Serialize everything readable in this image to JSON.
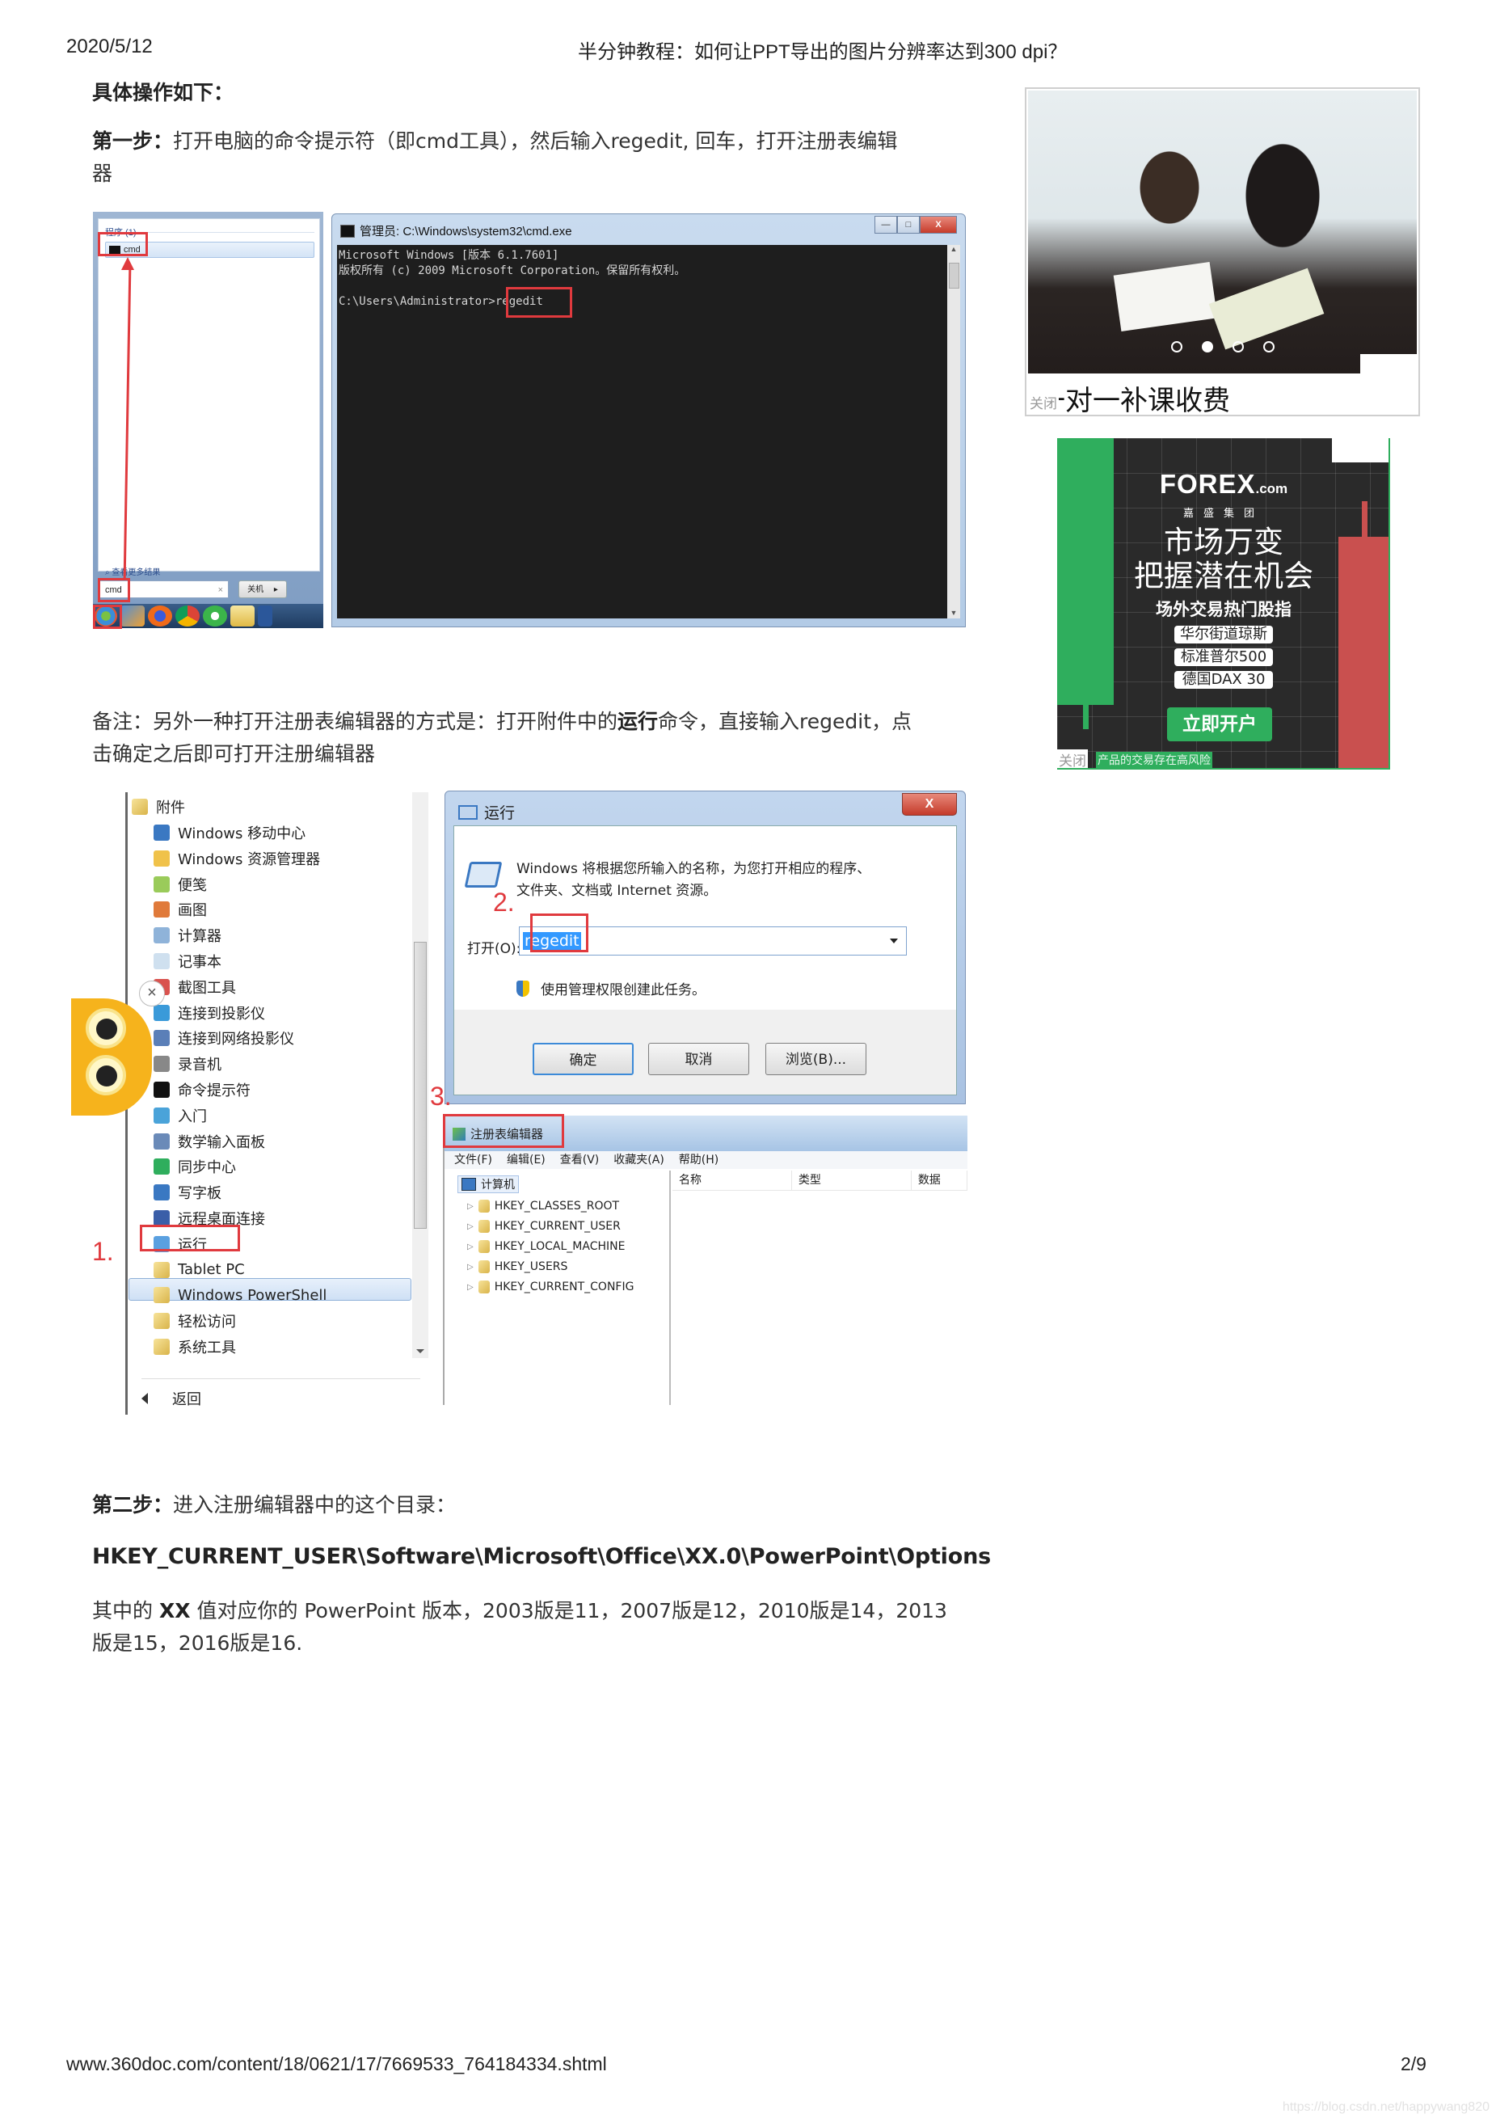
{
  "header": {
    "date": "2020/5/12",
    "title": "半分钟教程：如何让PPT导出的图片分辨率达到300 dpi？"
  },
  "article": {
    "intro_heading": "具体操作如下：",
    "step1": {
      "label": "第一步：",
      "text": "打开电脑的命令提示符（即cmd工具），然后输入regedit, 回车，打开注册表编辑",
      "text_cont": "器"
    },
    "note": {
      "prefix": "备注：另外一种打开注册表编辑器的方式是：打开附件中的",
      "bold": "运行",
      "suffix": "命令，直接输入regedit，点",
      "line2": "击确定之后即可打开注册编辑器"
    },
    "step2": {
      "label": "第二步：",
      "text": "进入注册编辑器中的这个目录："
    },
    "registry_path": "HKEY_CURRENT_USER\\Software\\Microsoft\\Office\\XX.0\\PowerPoint\\Options",
    "versions": {
      "prefix": "其中的 ",
      "bold": "XX",
      "suffix": " 值对应你的 PowerPoint 版本，2003版是11，2007版是12，2010版是14，2013",
      "line2": "版是15，2016版是16."
    }
  },
  "screenshot1": {
    "start_menu": {
      "category": "程序 (1)",
      "result": "cmd",
      "more_results": "查看更多结果",
      "search_value": "cmd",
      "search_clear": "×",
      "shutdown": "关机",
      "shutdown_arrow": "▸"
    },
    "cmd_window": {
      "title": "管理员: C:\\Windows\\system32\\cmd.exe",
      "minimize": "—",
      "maximize": "□",
      "close": "X",
      "line1": "Microsoft Windows [版本 6.1.7601]",
      "line2": "版权所有 (c) 2009 Microsoft Corporation。保留所有权利。",
      "prompt": "C:\\Users\\Administrator>",
      "command": "regedit",
      "scroll_up": "▲",
      "scroll_down": "▼"
    }
  },
  "screenshot2": {
    "accessories": {
      "folder": "附件",
      "items": [
        "Windows 移动中心",
        "Windows 资源管理器",
        "便笺",
        "画图",
        "计算器",
        "记事本",
        "截图工具",
        "连接到投影仪",
        "连接到网络投影仪",
        "录音机",
        "命令提示符",
        "入门",
        "数学输入面板",
        "同步中心",
        "写字板",
        "远程桌面连接",
        "运行"
      ],
      "folders": [
        "Tablet PC",
        "Windows PowerShell",
        "轻松访问",
        "系统工具"
      ],
      "back": "返回"
    },
    "markers": [
      "1.",
      "2.",
      "3."
    ],
    "owl_close": "×",
    "run_dialog": {
      "title": "运行",
      "close": "X",
      "description_line1": "Windows 将根据您所输入的名称，为您打开相应的程序、",
      "description_line2": "文件夹、文档或 Internet 资源。",
      "open_label": "打开(O):",
      "input_value": "regedit",
      "admin_note": "使用管理权限创建此任务。",
      "ok": "确定",
      "cancel": "取消",
      "browse": "浏览(B)..."
    },
    "regedit": {
      "title": "注册表编辑器",
      "menu": [
        "文件(F)",
        "编辑(E)",
        "查看(V)",
        "收藏夹(A)",
        "帮助(H)"
      ],
      "root": "计算机",
      "keys": [
        "HKEY_CLASSES_ROOT",
        "HKEY_CURRENT_USER",
        "HKEY_LOCAL_MACHINE",
        "HKEY_USERS",
        "HKEY_CURRENT_CONFIG"
      ],
      "columns": [
        "名称",
        "类型",
        "数据"
      ]
    }
  },
  "ads": {
    "ad1": {
      "title": "一对一补课收费",
      "close": "关闭",
      "slides_total": 4,
      "slide_active": 2
    },
    "ad2": {
      "brand": "FOREX",
      "brand_suffix": ".com",
      "brand_sub": "嘉盛集团",
      "headline1": "市场万变",
      "headline2": "把握潜在机会",
      "subheadline": "场外交易热门股指",
      "tags": [
        "华尔街道琼斯",
        "标准普尔500",
        "德国DAX 30"
      ],
      "cta": "立即开户",
      "risk": "产品的交易存在高风险",
      "close": "关闭",
      "colors": {
        "green": "#2fae5d",
        "red": "#c9504f",
        "dark": "#2a2a2a"
      }
    }
  },
  "footer": {
    "url": "www.360doc.com/content/18/0621/17/7669533_764184334.shtml",
    "page": "2/9",
    "watermark": "https://blog.csdn.net/happywang820"
  }
}
